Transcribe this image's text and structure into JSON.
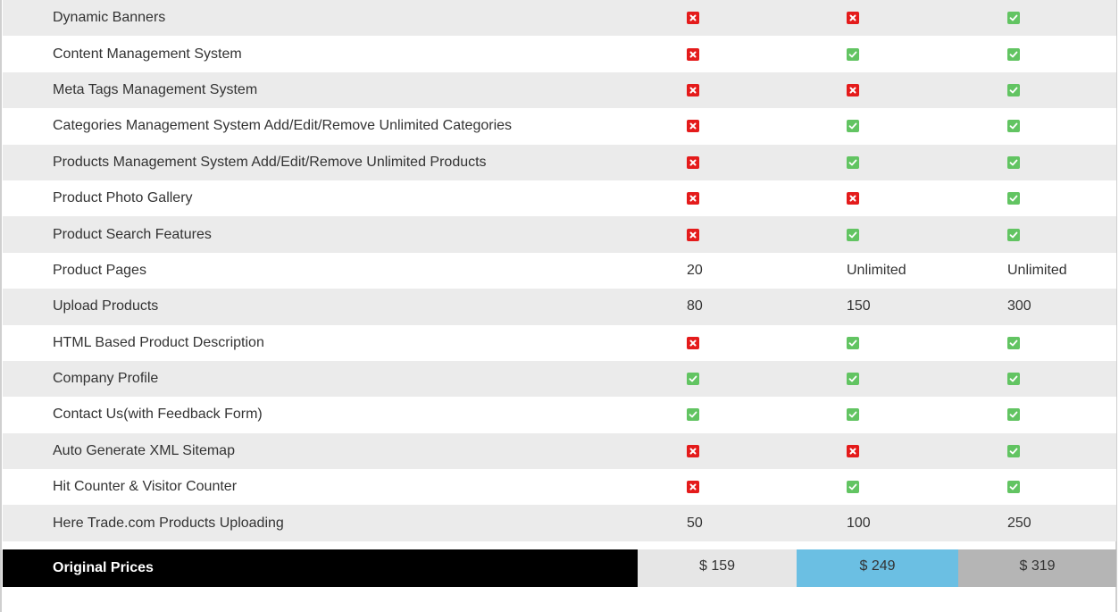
{
  "rows": [
    {
      "feature": "Dynamic Banners",
      "cols": [
        "no",
        "no",
        "yes"
      ]
    },
    {
      "feature": "Content Management System",
      "cols": [
        "no",
        "yes",
        "yes"
      ]
    },
    {
      "feature": "Meta Tags Management System",
      "cols": [
        "no",
        "no",
        "yes"
      ]
    },
    {
      "feature": "Categories Management System Add/Edit/Remove Unlimited Categories",
      "cols": [
        "no",
        "yes",
        "yes"
      ]
    },
    {
      "feature": "Products Management System Add/Edit/Remove Unlimited Products",
      "cols": [
        "no",
        "yes",
        "yes"
      ]
    },
    {
      "feature": "Product Photo Gallery",
      "cols": [
        "no",
        "no",
        "yes"
      ]
    },
    {
      "feature": "Product Search Features",
      "cols": [
        "no",
        "yes",
        "yes"
      ]
    },
    {
      "feature": "Product Pages",
      "cols": [
        "20",
        "Unlimited",
        "Unlimited"
      ]
    },
    {
      "feature": "Upload Products",
      "cols": [
        "80",
        "150",
        "300"
      ]
    },
    {
      "feature": "HTML Based Product Description",
      "cols": [
        "no",
        "yes",
        "yes"
      ]
    },
    {
      "feature": "Company Profile",
      "cols": [
        "yes",
        "yes",
        "yes"
      ]
    },
    {
      "feature": "Contact Us(with Feedback Form)",
      "cols": [
        "yes",
        "yes",
        "yes"
      ]
    },
    {
      "feature": "Auto Generate XML Sitemap",
      "cols": [
        "no",
        "no",
        "yes"
      ]
    },
    {
      "feature": "Hit Counter & Visitor Counter",
      "cols": [
        "no",
        "yes",
        "yes"
      ]
    },
    {
      "feature": "Here Trade.com Products Uploading",
      "cols": [
        "50",
        "100",
        "250"
      ]
    }
  ],
  "pricing": {
    "label": "Original Prices",
    "prices": [
      "$ 159",
      "$ 249",
      "$ 319"
    ]
  },
  "icons": {
    "yes": "check-icon",
    "no": "cross-icon"
  },
  "colors": {
    "check": "#62c462",
    "cross": "#e41b1b",
    "price_highlight": "#6bbfe3"
  }
}
